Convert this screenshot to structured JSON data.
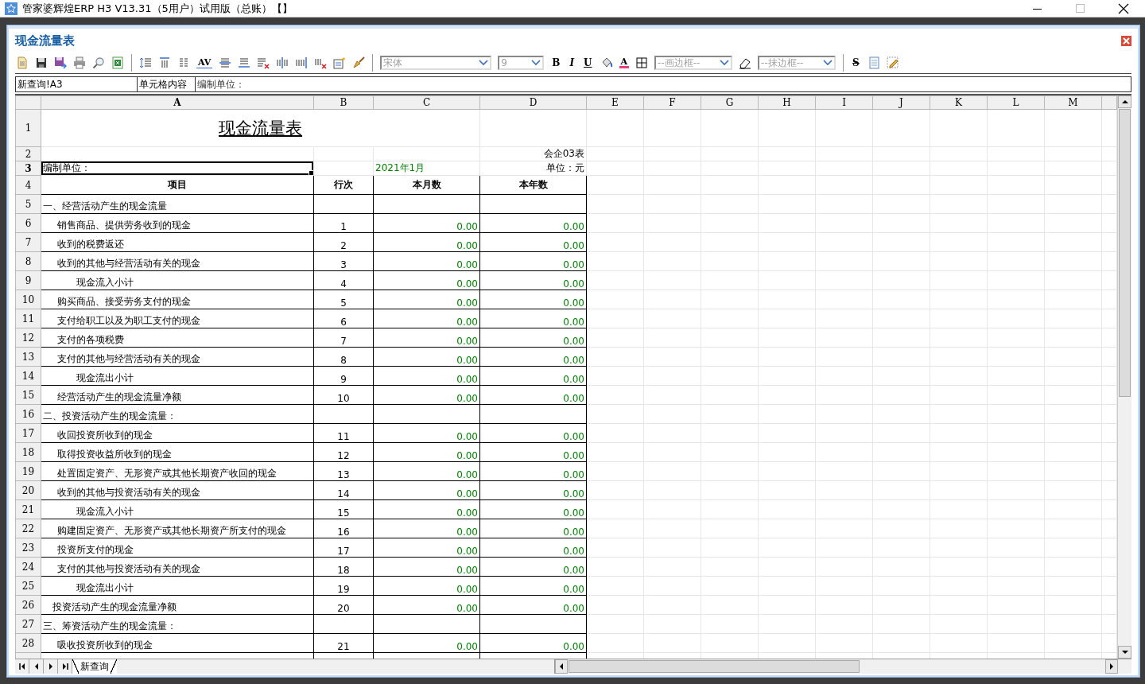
{
  "window": {
    "title": "管家婆辉煌ERP H3 V13.31（5用户）试用版（总账）【】"
  },
  "panel": {
    "title": "现金流量表"
  },
  "toolbar": {
    "spacing": "AV",
    "font": {
      "value": "宋体",
      "disabled": true
    },
    "size": {
      "value": "9",
      "disabled": true
    },
    "bold": "B",
    "italic": "I",
    "underline": "U",
    "font_color": "A",
    "draw_border": {
      "value": "--画边框--",
      "disabled": true
    },
    "erase_border": {
      "value": "--抹边框--",
      "disabled": true
    },
    "strike": "S"
  },
  "formula_bar": {
    "cell_ref": "新查询!A3",
    "label": "单元格内容",
    "content": "编制单位："
  },
  "sheet": {
    "columns": [
      {
        "label": "A",
        "selected": true
      },
      {
        "label": "B",
        "selected": false
      },
      {
        "label": "C",
        "selected": false
      },
      {
        "label": "D",
        "selected": false
      },
      {
        "label": "E",
        "selected": false
      },
      {
        "label": "F",
        "selected": false
      },
      {
        "label": "G",
        "selected": false
      },
      {
        "label": "H",
        "selected": false
      },
      {
        "label": "I",
        "selected": false
      },
      {
        "label": "J",
        "selected": false
      },
      {
        "label": "K",
        "selected": false
      },
      {
        "label": "L",
        "selected": false
      },
      {
        "label": "M",
        "selected": false
      }
    ],
    "rows": [
      {
        "number": "1",
        "selected": false,
        "kind": "title",
        "title": "现金流量表"
      },
      {
        "number": "2",
        "selected": false,
        "kind": "note",
        "d": "会企03表"
      },
      {
        "number": "3",
        "selected": true,
        "kind": "unit",
        "a": "编制单位：",
        "c": "2021年1月",
        "d": "单位：元"
      },
      {
        "number": "4",
        "selected": false,
        "kind": "header",
        "a": "项目",
        "b": "行次",
        "c": "本月数",
        "d": "本年数"
      },
      {
        "number": "5",
        "selected": false,
        "kind": "section",
        "a": "一、经营活动产生的现金流量"
      },
      {
        "number": "6",
        "selected": false,
        "kind": "item",
        "a": "销售商品、提供劳务收到的现金",
        "b": "1",
        "c": "0.00",
        "d": "0.00"
      },
      {
        "number": "7",
        "selected": false,
        "kind": "item",
        "a": "收到的税费返还",
        "b": "2",
        "c": "0.00",
        "d": "0.00"
      },
      {
        "number": "8",
        "selected": false,
        "kind": "item",
        "a": "收到的其他与经营活动有关的现金",
        "b": "3",
        "c": "0.00",
        "d": "0.00"
      },
      {
        "number": "9",
        "selected": false,
        "kind": "subtotal",
        "a": "现金流入小计",
        "b": "4",
        "c": "0.00",
        "d": "0.00"
      },
      {
        "number": "10",
        "selected": false,
        "kind": "item",
        "a": "购买商品、接受劳务支付的现金",
        "b": "5",
        "c": "0.00",
        "d": "0.00"
      },
      {
        "number": "11",
        "selected": false,
        "kind": "item",
        "a": "支付给职工以及为职工支付的现金",
        "b": "6",
        "c": "0.00",
        "d": "0.00"
      },
      {
        "number": "12",
        "selected": false,
        "kind": "item",
        "a": "支付的各项税费",
        "b": "7",
        "c": "0.00",
        "d": "0.00"
      },
      {
        "number": "13",
        "selected": false,
        "kind": "item",
        "a": "支付的其他与经营活动有关的现金",
        "b": "8",
        "c": "0.00",
        "d": "0.00"
      },
      {
        "number": "14",
        "selected": false,
        "kind": "subtotal",
        "a": "现金流出小计",
        "b": "9",
        "c": "0.00",
        "d": "0.00"
      },
      {
        "number": "15",
        "selected": false,
        "kind": "item",
        "a": "经营活动产生的现金流量净额",
        "b": "10",
        "c": "0.00",
        "d": "0.00"
      },
      {
        "number": "16",
        "selected": false,
        "kind": "section",
        "a": "二、投资活动产生的现金流量："
      },
      {
        "number": "17",
        "selected": false,
        "kind": "item",
        "a": "收回投资所收到的现金",
        "b": "11",
        "c": "0.00",
        "d": "0.00"
      },
      {
        "number": "18",
        "selected": false,
        "kind": "item",
        "a": "取得投资收益所收到的现金",
        "b": "12",
        "c": "0.00",
        "d": "0.00"
      },
      {
        "number": "19",
        "selected": false,
        "kind": "item",
        "a": "处置固定资产、无形资产或其他长期资产收回的现金",
        "b": "13",
        "c": "0.00",
        "d": "0.00"
      },
      {
        "number": "20",
        "selected": false,
        "kind": "item",
        "a": "收到的其他与投资活动有关的现金",
        "b": "14",
        "c": "0.00",
        "d": "0.00"
      },
      {
        "number": "21",
        "selected": false,
        "kind": "subtotal",
        "a": "现金流入小计",
        "b": "15",
        "c": "0.00",
        "d": "0.00"
      },
      {
        "number": "22",
        "selected": false,
        "kind": "item",
        "a": "购建固定资产、无形资产或其他长期资产所支付的现金",
        "b": "16",
        "c": "0.00",
        "d": "0.00"
      },
      {
        "number": "23",
        "selected": false,
        "kind": "item",
        "a": "投资所支付的现金",
        "b": "17",
        "c": "0.00",
        "d": "0.00"
      },
      {
        "number": "24",
        "selected": false,
        "kind": "item",
        "a": "支付的其他与投资活动有关的现金",
        "b": "18",
        "c": "0.00",
        "d": "0.00"
      },
      {
        "number": "25",
        "selected": false,
        "kind": "subtotal",
        "a": "现金流出小计",
        "b": "19",
        "c": "0.00",
        "d": "0.00"
      },
      {
        "number": "26",
        "selected": false,
        "kind": "total",
        "a": "投资活动产生的现金流量净额",
        "b": "20",
        "c": "0.00",
        "d": "0.00"
      },
      {
        "number": "27",
        "selected": false,
        "kind": "section",
        "a": "三、筹资活动产生的现金流量："
      },
      {
        "number": "28",
        "selected": false,
        "kind": "item",
        "a": "吸收投资所收到的现金",
        "b": "21",
        "c": "0.00",
        "d": "0.00"
      }
    ]
  },
  "sheet_tabs": [
    {
      "label": "新查询",
      "selected": true
    }
  ]
}
